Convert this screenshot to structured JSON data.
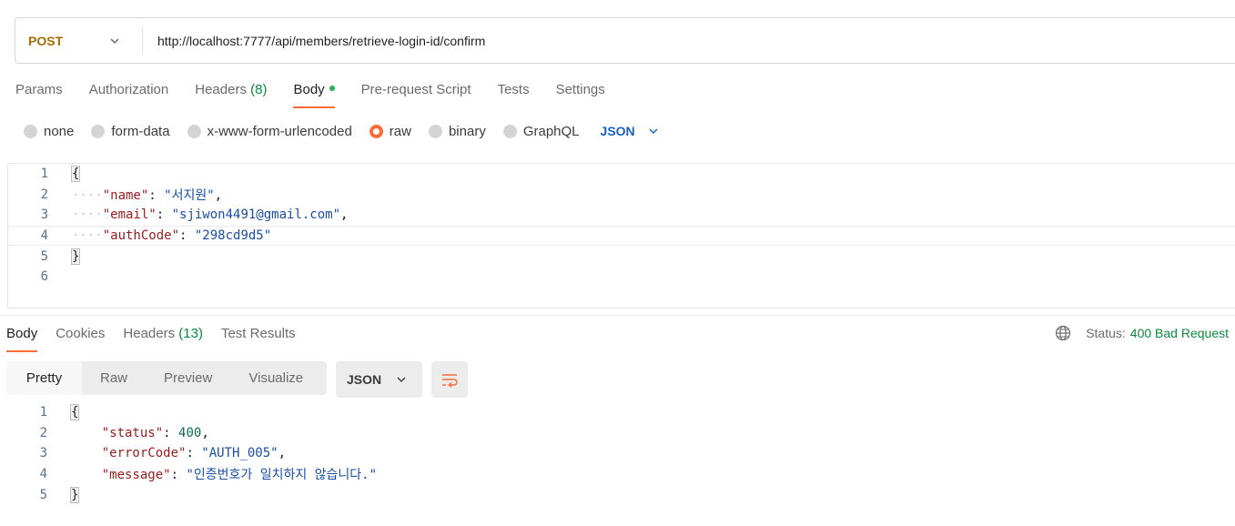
{
  "request": {
    "method": "POST",
    "url": "http://localhost:7777/api/members/retrieve-login-id/confirm"
  },
  "request_tabs": [
    {
      "label": "Params"
    },
    {
      "label": "Authorization"
    },
    {
      "label": "Headers",
      "count": "(8)"
    },
    {
      "label": "Body"
    },
    {
      "label": "Pre-request Script"
    },
    {
      "label": "Tests"
    },
    {
      "label": "Settings"
    }
  ],
  "body_types": [
    "none",
    "form-data",
    "x-www-form-urlencoded",
    "raw",
    "binary",
    "GraphQL"
  ],
  "selected_body_type": "raw",
  "raw_format": "JSON",
  "request_body": {
    "line_numbers": [
      "1",
      "2",
      "3",
      "4",
      "5",
      "6"
    ],
    "open": "{",
    "close": "}",
    "fields": [
      {
        "key": "\"name\"",
        "value": "\"서지원\"",
        "comma": ","
      },
      {
        "key": "\"email\"",
        "value": "\"sjiwon4491@gmail.com\"",
        "comma": ","
      },
      {
        "key": "\"authCode\"",
        "value": "\"298cd9d5\"",
        "comma": ""
      }
    ]
  },
  "response_tabs": [
    {
      "label": "Body"
    },
    {
      "label": "Cookies"
    },
    {
      "label": "Headers",
      "count": "(13)"
    },
    {
      "label": "Test Results"
    }
  ],
  "status": {
    "label": "Status:",
    "value": "400 Bad Request"
  },
  "view_modes": [
    "Pretty",
    "Raw",
    "Preview",
    "Visualize"
  ],
  "response_format": "JSON",
  "response_body": {
    "line_numbers": [
      "1",
      "2",
      "3",
      "4",
      "5"
    ],
    "open": "{",
    "close": "}",
    "fields": [
      {
        "key": "\"status\"",
        "value": "400",
        "comma": ","
      },
      {
        "key": "\"errorCode\"",
        "value": "\"AUTH_005\"",
        "comma": ","
      },
      {
        "key": "\"message\"",
        "value": "\"인증번호가 일치하지 않습니다.\"",
        "comma": ""
      }
    ]
  },
  "colors": {
    "accent": "#ff6c37",
    "method": "#a76c00",
    "success": "#0b8a3e",
    "link": "#1a5fc4"
  }
}
